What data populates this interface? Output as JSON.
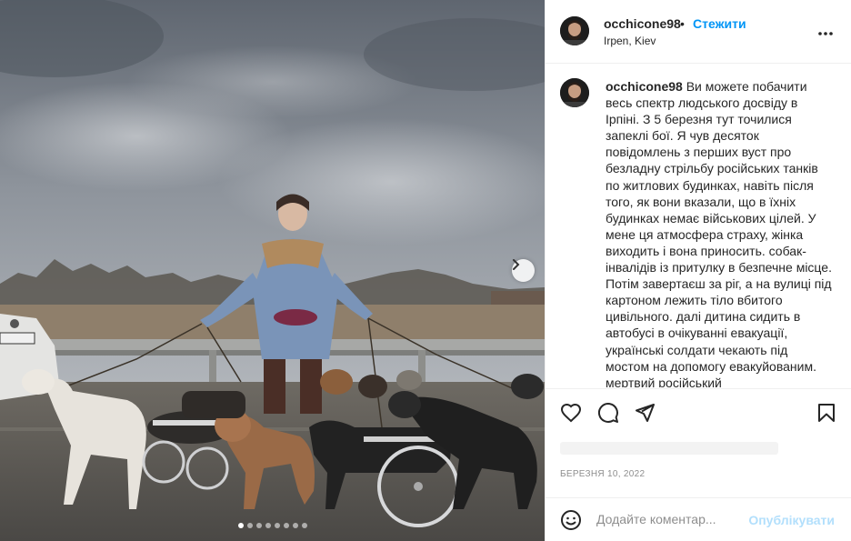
{
  "post": {
    "username": "occhicone98",
    "separator": "•",
    "follow_label": "Стежити",
    "location": "Irpen, Kiev",
    "more_icon": "more-horizontal-icon"
  },
  "caption": {
    "username": "occhicone98",
    "text": "Ви можете побачити весь спектр людського досвіду в Ірпіні. З 5 березня тут точилися запеклі бої. Я чув десяток повідомлень з перших вуст про безладну стрільбу російських танків по житлових будинках, навіть після того, як вони вказали, що в їхніх будинках немає військових цілей. У мене ця атмосфера страху, жінка виходить і вона приносить. собак-інвалідів із притулку в безпечне місце. Потім завертаєш за ріг, а на вулиці під картоном лежить тіло вбитого цивільного. далі дитина сидить в автобусі в очікуванні евакуації, українські солдати чекають під мостом на допомогу евакуйованим. мертвий російський"
  },
  "actions": {
    "like_icon": "heart-icon",
    "comment_icon": "comment-icon",
    "share_icon": "paper-plane-icon",
    "save_icon": "bookmark-icon"
  },
  "date": "БЕРЕЗНЯ 10, 2022",
  "comment_box": {
    "emoji_icon": "emoji-icon",
    "placeholder": "Додайте коментар...",
    "publish_label": "Опублікувати"
  },
  "carousel": {
    "total": 8,
    "active": 1
  },
  "colors": {
    "accent": "#0095f6",
    "publish_disabled": "#b2dffc",
    "border": "#efefef",
    "muted": "#8e8e8e"
  }
}
